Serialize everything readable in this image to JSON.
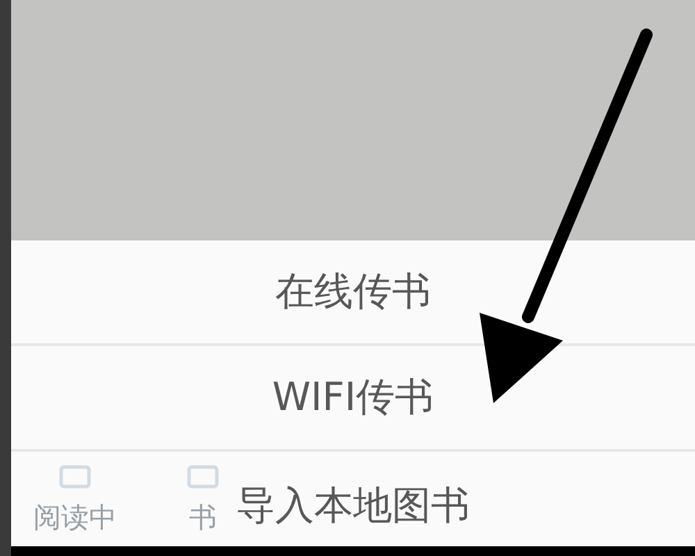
{
  "menu": {
    "items": [
      {
        "label": "在线传书"
      },
      {
        "label": "WIFI传书"
      },
      {
        "label": "导入本地图书"
      }
    ]
  },
  "tab_bar": {
    "tabs": [
      {
        "label": "阅读中"
      },
      {
        "label": "书"
      }
    ]
  }
}
